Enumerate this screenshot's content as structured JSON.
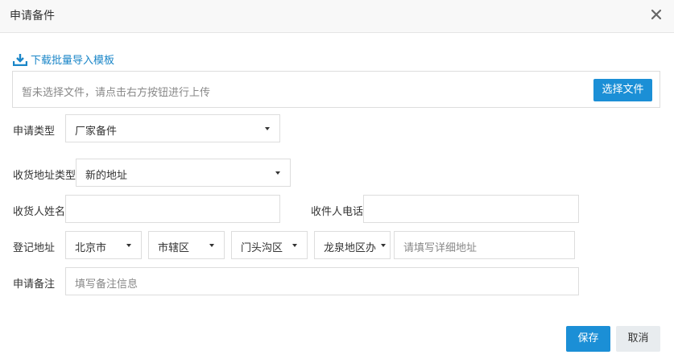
{
  "dialog": {
    "title": "申请备件",
    "close_icon": "close-icon"
  },
  "download": {
    "icon": "download-icon",
    "label": "下载批量导入模板",
    "color": "#1a86c8"
  },
  "upload": {
    "placeholder": "暂未选择文件，请点击右方按钮进行上传",
    "button_label": "选择文件"
  },
  "form": {
    "apply_type": {
      "label": "申请类型",
      "value": "厂家备件"
    },
    "address_type": {
      "label": "收货地址类型",
      "value": "新的地址"
    },
    "receiver_name": {
      "label": "收货人姓名",
      "value": ""
    },
    "receiver_phone": {
      "label": "收件人电话",
      "value": ""
    },
    "register_address": {
      "label": "登记地址",
      "city": "北京市",
      "district": "市辖区",
      "area": "门头沟区",
      "street": "龙泉地区办",
      "detail_placeholder": "请填写详细地址"
    },
    "remark": {
      "label": "申请备注",
      "placeholder": "填写备注信息"
    }
  },
  "footer": {
    "save_label": "保存",
    "cancel_label": "取消"
  },
  "colors": {
    "primary": "#1b8fd6",
    "secondary_button": "#e8ecef",
    "header_bg": "#f8f8f8"
  }
}
